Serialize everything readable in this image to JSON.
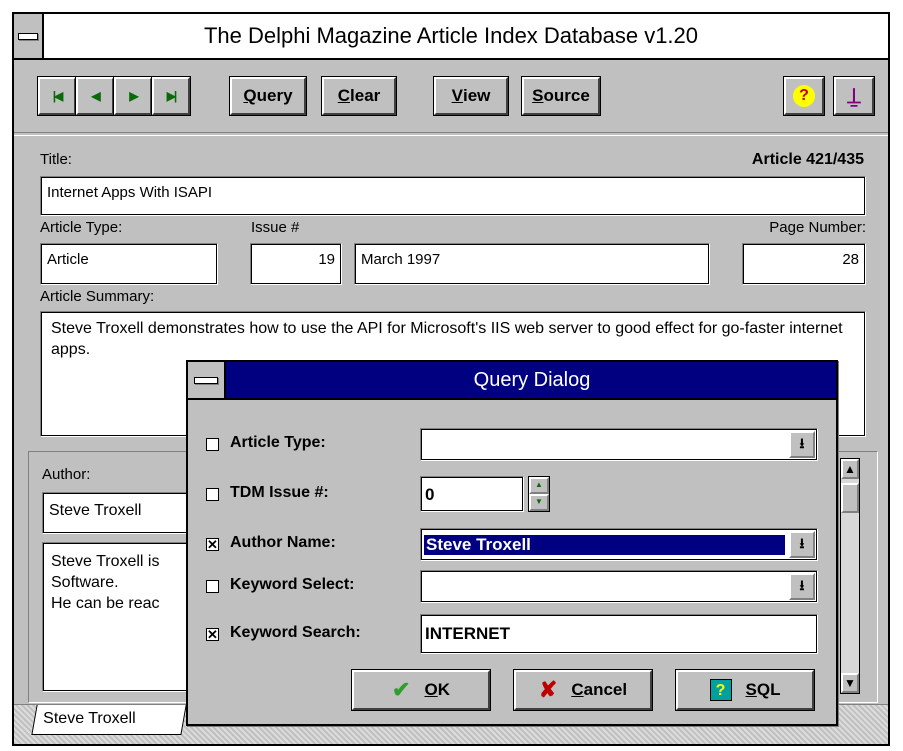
{
  "window": {
    "title": "The Delphi Magazine Article Index Database v1.20"
  },
  "toolbar": {
    "nav": [
      {
        "name": "first-record-button",
        "glyph": "|◀"
      },
      {
        "name": "prior-record-button",
        "glyph": "◀"
      },
      {
        "name": "next-record-button",
        "glyph": "▶"
      },
      {
        "name": "last-record-button",
        "glyph": "▶|"
      }
    ],
    "query": {
      "u": "Q",
      "rest": "uery"
    },
    "clear": {
      "u": "C",
      "rest": "lear"
    },
    "view": {
      "u": "V",
      "rest": "iew"
    },
    "source": {
      "u": "S",
      "rest": "ource"
    },
    "help_glyph": "?",
    "exit_glyph": "⍊"
  },
  "record": {
    "title_label": "Title:",
    "counter": "Article 421/435",
    "title_value": "Internet Apps With ISAPI",
    "type_label": "Article Type:",
    "type_value": "Article",
    "issue_label": "Issue #",
    "issue_value": "19",
    "issue_date": "March 1997",
    "page_label": "Page Number:",
    "page_value": "28",
    "summary_label": "Article Summary:",
    "summary_value": "Steve Troxell demonstrates how to use the API for Microsoft's IIS web server to good effect for go-faster internet apps."
  },
  "author": {
    "label": "Author:",
    "name": "Steve Troxell",
    "bio_line1": "Steve Troxell is",
    "bio_line2": "Software.",
    "bio_line3": "He can be reac",
    "tab": "Steve Troxell"
  },
  "query_dialog": {
    "title": "Query Dialog",
    "rows": {
      "article_type": {
        "label": "Article Type:",
        "checked": false,
        "mark": "",
        "value": ""
      },
      "issue": {
        "label": "TDM Issue #:",
        "checked": false,
        "mark": "",
        "value": "0"
      },
      "author_name": {
        "label": "Author Name:",
        "checked": true,
        "mark": "✕",
        "value": "Steve Troxell"
      },
      "keyword_select": {
        "label": "Keyword Select:",
        "checked": false,
        "mark": "",
        "value": ""
      },
      "keyword_search": {
        "label": "Keyword Search:",
        "checked": true,
        "mark": "✕",
        "value": "INTERNET"
      }
    },
    "ok": {
      "u": "O",
      "rest": "K"
    },
    "cancel": {
      "u": "C",
      "rest": "ancel"
    },
    "sql": {
      "u": "S",
      "rest": "QL"
    }
  },
  "colors": {
    "titlebar_active": "#000080",
    "face": "#c0c0c0",
    "ok_check": "#2e9e2e",
    "cancel_x": "#c00000"
  }
}
